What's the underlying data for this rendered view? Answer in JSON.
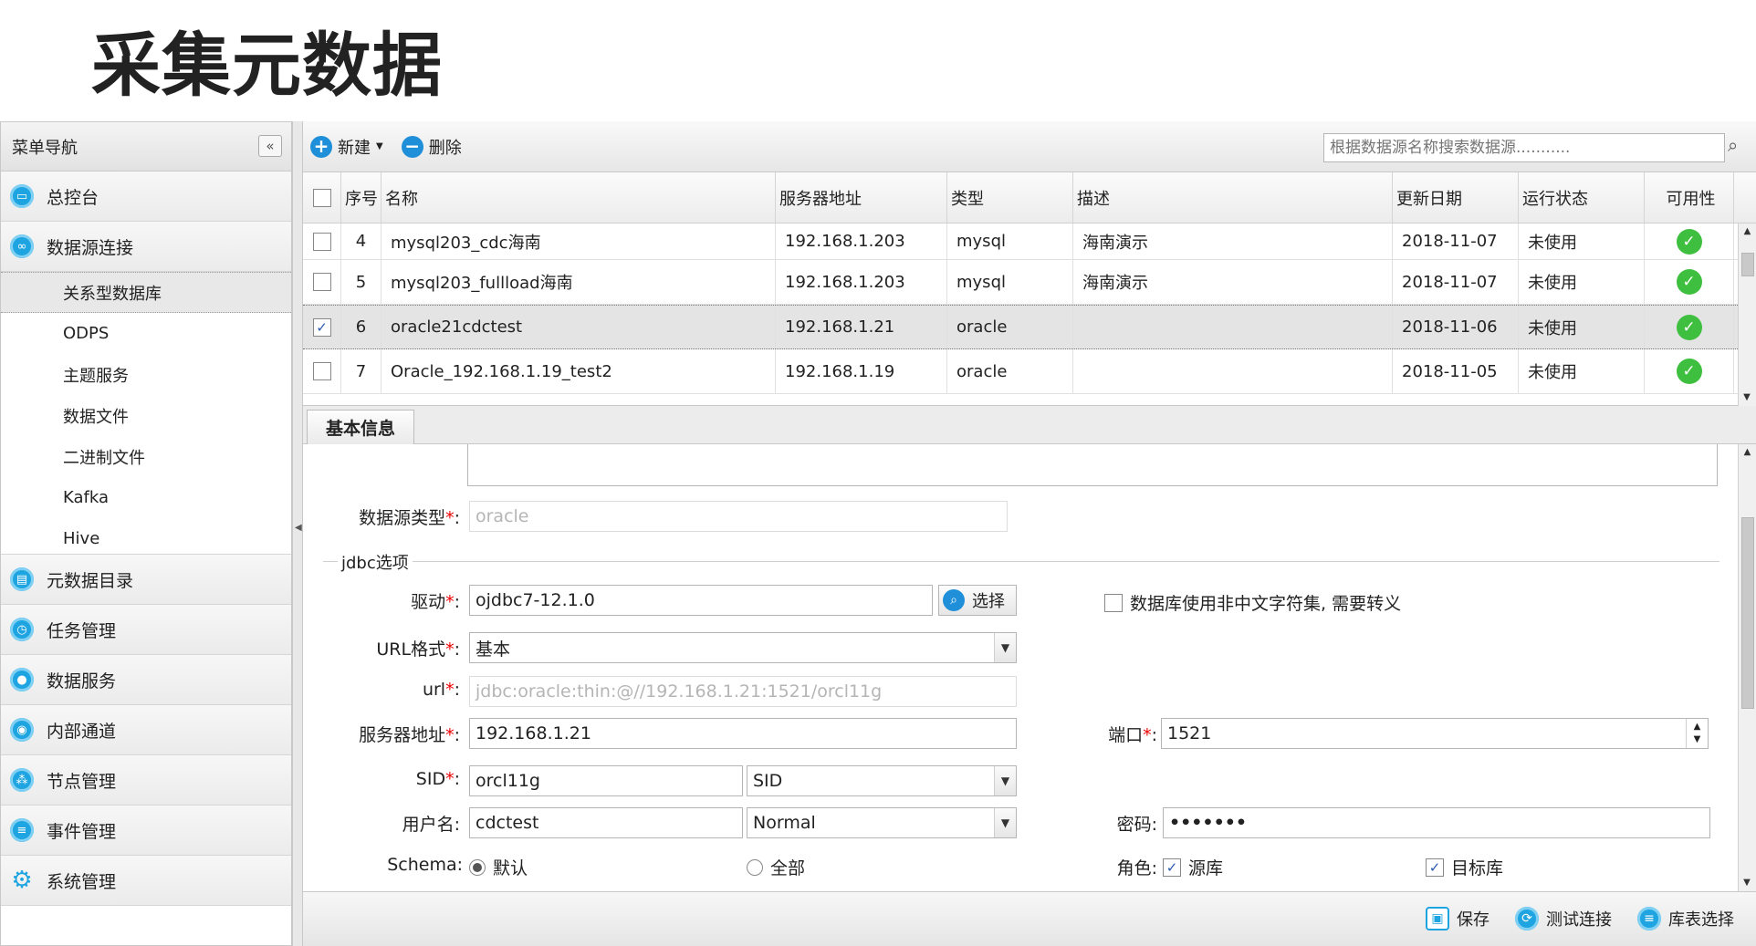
{
  "page_title": "采集元数据",
  "sidebar": {
    "header": "菜单导航",
    "collapse_icon": "«",
    "top_items": [
      {
        "label": "总控台"
      },
      {
        "label": "数据源连接"
      }
    ],
    "sub_items": [
      {
        "label": "关系型数据库"
      },
      {
        "label": "ODPS"
      },
      {
        "label": "主题服务"
      },
      {
        "label": "数据文件"
      },
      {
        "label": "二进制文件"
      },
      {
        "label": "Kafka"
      },
      {
        "label": "Hive"
      }
    ],
    "bottom_items": [
      {
        "label": "元数据目录"
      },
      {
        "label": "任务管理"
      },
      {
        "label": "数据服务"
      },
      {
        "label": "内部通道"
      },
      {
        "label": "节点管理"
      },
      {
        "label": "事件管理"
      },
      {
        "label": "系统管理"
      }
    ]
  },
  "toolbar": {
    "new_label": "新建",
    "delete_label": "删除",
    "search_placeholder": "根据数据源名称搜索数据源..........."
  },
  "grid": {
    "columns": [
      "序号",
      "名称",
      "服务器地址",
      "类型",
      "描述",
      "更新日期",
      "运行状态",
      "可用性"
    ],
    "rows": [
      {
        "checked": false,
        "no": "4",
        "name": "mysql203_cdc海南",
        "server": "192.168.1.203",
        "type": "mysql",
        "desc": "海南演示",
        "date": "2018-11-07",
        "status": "未使用"
      },
      {
        "checked": false,
        "no": "5",
        "name": "mysql203_fullload海南",
        "server": "192.168.1.203",
        "type": "mysql",
        "desc": "海南演示",
        "date": "2018-11-07",
        "status": "未使用"
      },
      {
        "checked": true,
        "no": "6",
        "name": "oracle21cdctest",
        "server": "192.168.1.21",
        "type": "oracle",
        "desc": "",
        "date": "2018-11-06",
        "status": "未使用"
      },
      {
        "checked": false,
        "no": "7",
        "name": "Oracle_192.168.1.19_test2",
        "server": "192.168.1.19",
        "type": "oracle",
        "desc": "",
        "date": "2018-11-05",
        "status": "未使用"
      }
    ]
  },
  "detail": {
    "tab_label": "基本信息",
    "ds_type_label": "数据源类型",
    "ds_type_value": "oracle",
    "jdbc_legend": "jdbc选项",
    "driver_label": "驱动",
    "driver_value": "ojdbc7-12.1.0",
    "choose_label": "选择",
    "escape_label": "数据库使用非中文字符集, 需要转义",
    "url_format_label": "URL格式",
    "url_format_value": "基本",
    "url_label": "url",
    "url_value": "jdbc:oracle:thin:@//192.168.1.21:1521/orcl11g",
    "server_label": "服务器地址",
    "server_value": "192.168.1.21",
    "port_label": "端口",
    "port_value": "1521",
    "sid_label": "SID",
    "sid_value": "orcl11g",
    "sid_type_value": "SID",
    "user_label": "用户名",
    "user_value": "cdctest",
    "role_mode_value": "Normal",
    "password_label": "密码",
    "password_value": "•••••••",
    "schema_label": "Schema",
    "schema_default": "默认",
    "schema_all": "全部",
    "role_label": "角色",
    "source_label": "源库",
    "target_label": "目标库"
  },
  "footer": {
    "save_label": "保存",
    "test_label": "测试连接",
    "table_select_label": "库表选择"
  },
  "colors": {
    "accent": "#1ea4e0",
    "ok": "#3fbf3f",
    "required": "#e00000"
  }
}
